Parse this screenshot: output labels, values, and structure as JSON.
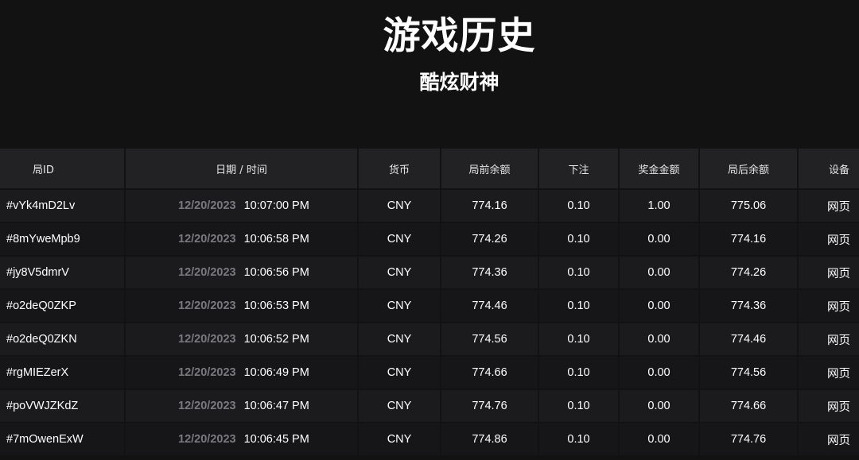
{
  "page": {
    "title": "游戏历史",
    "subtitle": "酷炫财神"
  },
  "table": {
    "columns": [
      "局ID",
      "日期 / 时间",
      "货币",
      "局前余额",
      "下注",
      "奖金金额",
      "局后余额",
      "设备"
    ],
    "rows": [
      {
        "id": "#vYk4mD2Lv",
        "date": "12/20/2023",
        "time": "10:07:00 PM",
        "currency": "CNY",
        "before": "774.16",
        "bet": "0.10",
        "win": "1.00",
        "after": "775.06",
        "device": "网页"
      },
      {
        "id": "#8mYweMpb9",
        "date": "12/20/2023",
        "time": "10:06:58 PM",
        "currency": "CNY",
        "before": "774.26",
        "bet": "0.10",
        "win": "0.00",
        "after": "774.16",
        "device": "网页"
      },
      {
        "id": "#jy8V5dmrV",
        "date": "12/20/2023",
        "time": "10:06:56 PM",
        "currency": "CNY",
        "before": "774.36",
        "bet": "0.10",
        "win": "0.00",
        "after": "774.26",
        "device": "网页"
      },
      {
        "id": "#o2deQ0ZKP",
        "date": "12/20/2023",
        "time": "10:06:53 PM",
        "currency": "CNY",
        "before": "774.46",
        "bet": "0.10",
        "win": "0.00",
        "after": "774.36",
        "device": "网页"
      },
      {
        "id": "#o2deQ0ZKN",
        "date": "12/20/2023",
        "time": "10:06:52 PM",
        "currency": "CNY",
        "before": "774.56",
        "bet": "0.10",
        "win": "0.00",
        "after": "774.46",
        "device": "网页"
      },
      {
        "id": "#rgMIEZerX",
        "date": "12/20/2023",
        "time": "10:06:49 PM",
        "currency": "CNY",
        "before": "774.66",
        "bet": "0.10",
        "win": "0.00",
        "after": "774.56",
        "device": "网页"
      },
      {
        "id": "#poVWJZKdZ",
        "date": "12/20/2023",
        "time": "10:06:47 PM",
        "currency": "CNY",
        "before": "774.76",
        "bet": "0.10",
        "win": "0.00",
        "after": "774.66",
        "device": "网页"
      },
      {
        "id": "#7mOwenExW",
        "date": "12/20/2023",
        "time": "10:06:45 PM",
        "currency": "CNY",
        "before": "774.86",
        "bet": "0.10",
        "win": "0.00",
        "after": "774.76",
        "device": "网页"
      }
    ]
  }
}
